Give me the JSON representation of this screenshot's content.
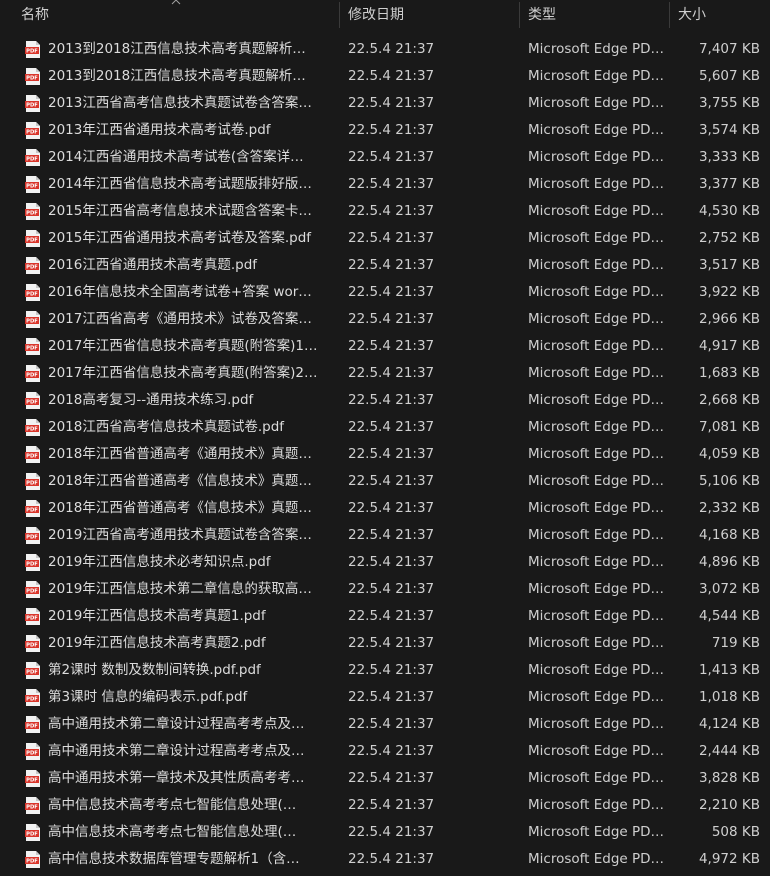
{
  "columns": {
    "name": "名称",
    "date": "修改日期",
    "type": "类型",
    "size": "大小"
  },
  "sort_icon": "chevron-up-icon",
  "file_icon": "pdf-file-icon",
  "colors": {
    "background": "#191919",
    "text": "#d8d8d8",
    "pdf_icon": "#d9352b"
  },
  "files": [
    {
      "name": "2013到2018江西信息技术高考真题解析…",
      "date": "22.5.4 21:37",
      "type": "Microsoft Edge PD…",
      "size": "7,407 KB"
    },
    {
      "name": "2013到2018江西信息技术高考真题解析…",
      "date": "22.5.4 21:37",
      "type": "Microsoft Edge PD…",
      "size": "5,607 KB"
    },
    {
      "name": "2013江西省高考信息技术真题试卷含答案…",
      "date": "22.5.4 21:37",
      "type": "Microsoft Edge PD…",
      "size": "3,755 KB"
    },
    {
      "name": "2013年江西省通用技术高考试卷.pdf",
      "date": "22.5.4 21:37",
      "type": "Microsoft Edge PD…",
      "size": "3,574 KB"
    },
    {
      "name": "2014江西省通用技术高考试卷(含答案详…",
      "date": "22.5.4 21:37",
      "type": "Microsoft Edge PD…",
      "size": "3,333 KB"
    },
    {
      "name": "2014年江西省信息技术高考试题版排好版…",
      "date": "22.5.4 21:37",
      "type": "Microsoft Edge PD…",
      "size": "3,377 KB"
    },
    {
      "name": "2015年江西省高考信息技术试题含答案卡…",
      "date": "22.5.4 21:37",
      "type": "Microsoft Edge PD…",
      "size": "4,530 KB"
    },
    {
      "name": "2015年江西省通用技术高考试卷及答案.pdf",
      "date": "22.5.4 21:37",
      "type": "Microsoft Edge PD…",
      "size": "2,752 KB"
    },
    {
      "name": "2016江西省通用技术高考真题.pdf",
      "date": "22.5.4 21:37",
      "type": "Microsoft Edge PD…",
      "size": "3,517 KB"
    },
    {
      "name": "2016年信息技术全国高考试卷+答案 wor…",
      "date": "22.5.4 21:37",
      "type": "Microsoft Edge PD…",
      "size": "3,922 KB"
    },
    {
      "name": "2017江西省高考《通用技术》试卷及答案…",
      "date": "22.5.4 21:37",
      "type": "Microsoft Edge PD…",
      "size": "2,966 KB"
    },
    {
      "name": "2017年江西省信息技术高考真题(附答案)1…",
      "date": "22.5.4 21:37",
      "type": "Microsoft Edge PD…",
      "size": "4,917 KB"
    },
    {
      "name": "2017年江西省信息技术高考真题(附答案)2…",
      "date": "22.5.4 21:37",
      "type": "Microsoft Edge PD…",
      "size": "1,683 KB"
    },
    {
      "name": "2018高考复习--通用技术练习.pdf",
      "date": "22.5.4 21:37",
      "type": "Microsoft Edge PD…",
      "size": "2,668 KB"
    },
    {
      "name": "2018江西省高考信息技术真题试卷.pdf",
      "date": "22.5.4 21:37",
      "type": "Microsoft Edge PD…",
      "size": "7,081 KB"
    },
    {
      "name": "2018年江西省普通高考《通用技术》真题…",
      "date": "22.5.4 21:37",
      "type": "Microsoft Edge PD…",
      "size": "4,059 KB"
    },
    {
      "name": "2018年江西省普通高考《信息技术》真题…",
      "date": "22.5.4 21:37",
      "type": "Microsoft Edge PD…",
      "size": "5,106 KB"
    },
    {
      "name": "2018年江西省普通高考《信息技术》真题…",
      "date": "22.5.4 21:37",
      "type": "Microsoft Edge PD…",
      "size": "2,332 KB"
    },
    {
      "name": "2019江西省高考通用技术真题试卷含答案…",
      "date": "22.5.4 21:37",
      "type": "Microsoft Edge PD…",
      "size": "4,168 KB"
    },
    {
      "name": "2019年江西信息技术必考知识点.pdf",
      "date": "22.5.4 21:37",
      "type": "Microsoft Edge PD…",
      "size": "4,896 KB"
    },
    {
      "name": "2019年江西信息技术第二章信息的获取高…",
      "date": "22.5.4 21:37",
      "type": "Microsoft Edge PD…",
      "size": "3,072 KB"
    },
    {
      "name": "2019年江西信息技术高考真题1.pdf",
      "date": "22.5.4 21:37",
      "type": "Microsoft Edge PD…",
      "size": "4,544 KB"
    },
    {
      "name": "2019年江西信息技术高考真题2.pdf",
      "date": "22.5.4 21:37",
      "type": "Microsoft Edge PD…",
      "size": "719 KB"
    },
    {
      "name": "第2课时 数制及数制间转换.pdf.pdf",
      "date": "22.5.4 21:37",
      "type": "Microsoft Edge PD…",
      "size": "1,413 KB"
    },
    {
      "name": "第3课时 信息的编码表示.pdf.pdf",
      "date": "22.5.4 21:37",
      "type": "Microsoft Edge PD…",
      "size": "1,018 KB"
    },
    {
      "name": "高中通用技术第二章设计过程高考考点及…",
      "date": "22.5.4 21:37",
      "type": "Microsoft Edge PD…",
      "size": "4,124 KB"
    },
    {
      "name": "高中通用技术第二章设计过程高考考点及…",
      "date": "22.5.4 21:37",
      "type": "Microsoft Edge PD…",
      "size": "2,444 KB"
    },
    {
      "name": "高中通用技术第一章技术及其性质高考考…",
      "date": "22.5.4 21:37",
      "type": "Microsoft Edge PD…",
      "size": "3,828 KB"
    },
    {
      "name": "高中信息技术高考考点七智能信息处理(…",
      "date": "22.5.4 21:37",
      "type": "Microsoft Edge PD…",
      "size": "2,210 KB"
    },
    {
      "name": "高中信息技术高考考点七智能信息处理(…",
      "date": "22.5.4 21:37",
      "type": "Microsoft Edge PD…",
      "size": "508 KB"
    },
    {
      "name": "高中信息技术数据库管理专题解析1（含…",
      "date": "22.5.4 21:37",
      "type": "Microsoft Edge PD…",
      "size": "4,972 KB"
    }
  ]
}
